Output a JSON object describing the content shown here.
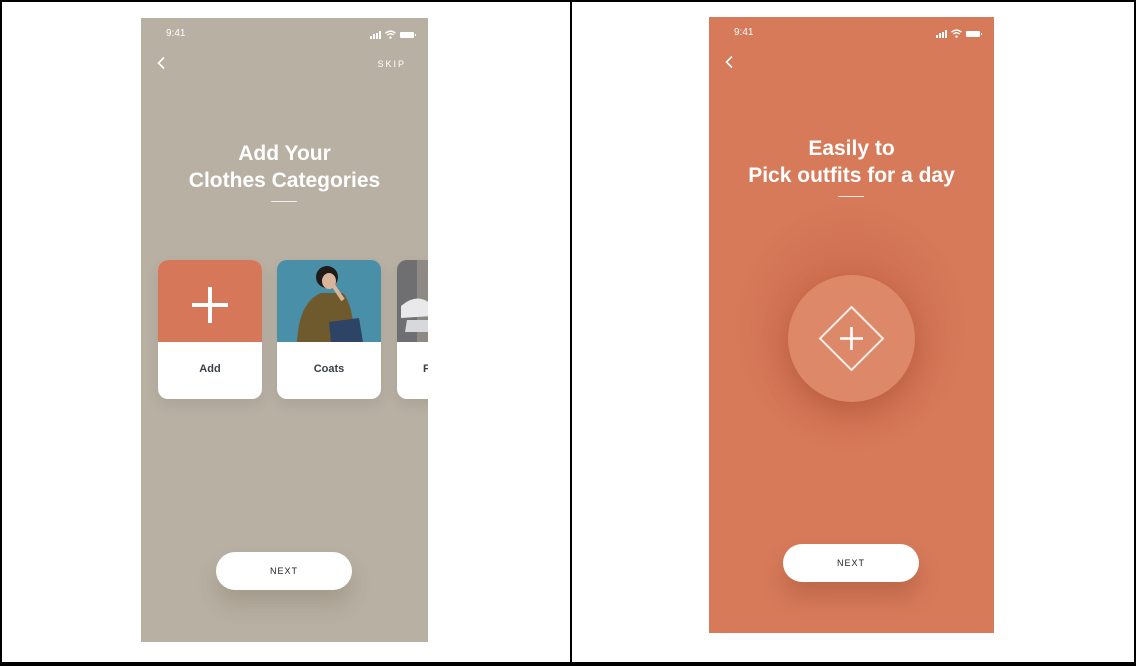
{
  "screen1": {
    "time": "9:41",
    "skip_label": "SKIP",
    "title_line1": "Add Your",
    "title_line2": "Clothes Categories",
    "cards": [
      {
        "label": "Add"
      },
      {
        "label": "Coats"
      },
      {
        "label": "F"
      }
    ],
    "next_label": "NEXT"
  },
  "screen2": {
    "time": "9:41",
    "title_line1": "Easily to",
    "title_line2": "Pick outfits for a day",
    "next_label": "NEXT"
  },
  "colors": {
    "screen1_bg": "#b8b0a3",
    "screen2_bg": "#d67a5a",
    "accent": "#d6775a",
    "button": "#ffffff"
  },
  "icons": [
    "chevron-left-icon",
    "signal-icon",
    "wifi-icon",
    "battery-icon",
    "plus-icon",
    "diamond-plus-icon"
  ]
}
